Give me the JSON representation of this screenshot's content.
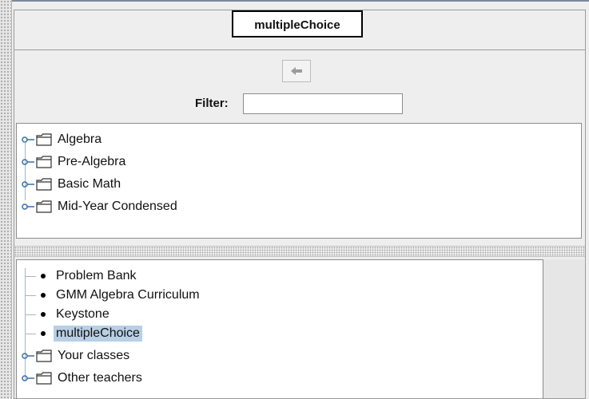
{
  "title": "multipleChoice",
  "filter": {
    "label": "Filter:",
    "value": ""
  },
  "top_tree": [
    {
      "label": "Algebra",
      "type": "folder"
    },
    {
      "label": "Pre-Algebra",
      "type": "folder"
    },
    {
      "label": "Basic Math",
      "type": "folder"
    },
    {
      "label": "Mid-Year Condensed",
      "type": "folder"
    }
  ],
  "bottom_tree": [
    {
      "label": "Problem Bank",
      "type": "leaf",
      "selected": false
    },
    {
      "label": "GMM Algebra Curriculum",
      "type": "leaf",
      "selected": false
    },
    {
      "label": "Keystone",
      "type": "leaf",
      "selected": false
    },
    {
      "label": "multipleChoice",
      "type": "leaf",
      "selected": true
    },
    {
      "label": "Your classes",
      "type": "folder",
      "selected": false
    },
    {
      "label": "Other teachers",
      "type": "folder",
      "selected": false
    }
  ],
  "icons": {
    "back": "left-arrow-icon",
    "folder": "folder-icon",
    "expand": "expand-handle-icon",
    "leaf": "bullet-icon"
  },
  "colors": {
    "selection": "#b8cfe5",
    "tree_line": "#aab6c2",
    "background": "#eeeeee"
  }
}
